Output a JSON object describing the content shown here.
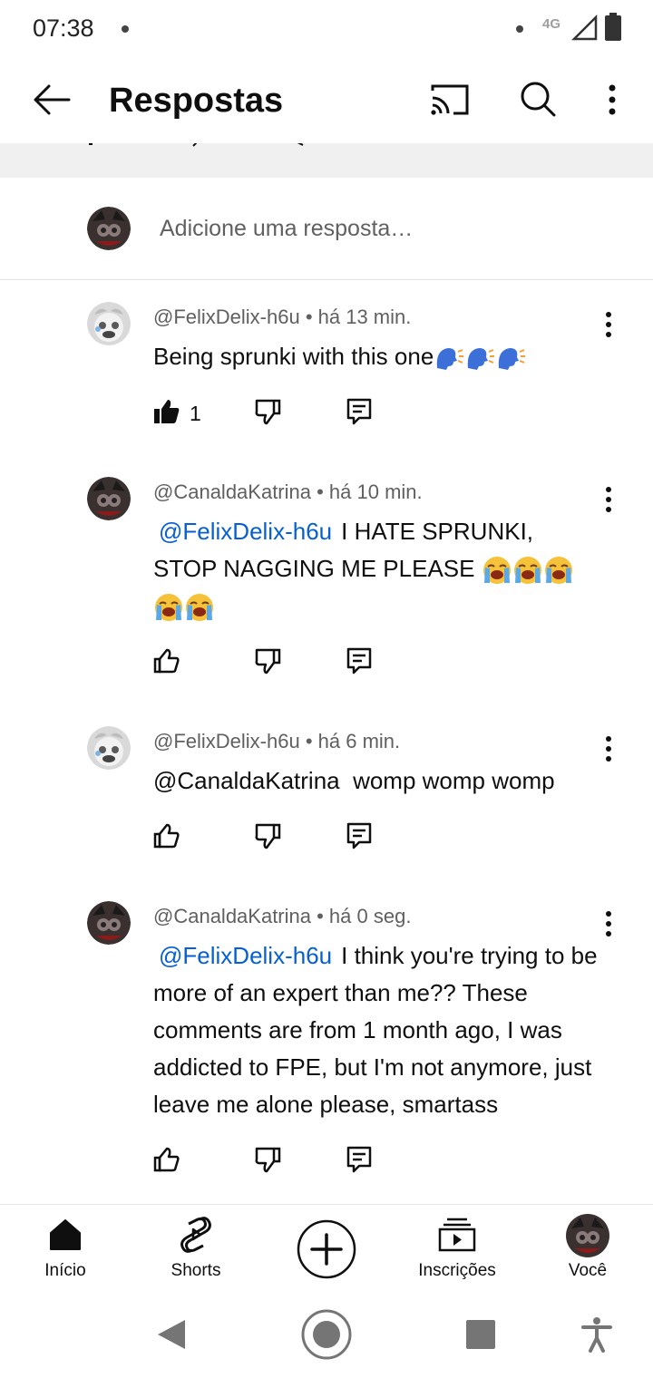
{
  "status": {
    "time": "07:38",
    "network": "4G"
  },
  "header": {
    "title": "Respostas"
  },
  "add_reply": {
    "placeholder": "Adicione uma resposta…"
  },
  "comments": [
    {
      "author": "@FelixDelix-h6u",
      "age": "há 13 min.",
      "meta": "@FelixDelix-h6u • há 13 min.",
      "text": "Being sprunki with this one",
      "emoji": [
        "speaking-head",
        "speaking-head",
        "speaking-head"
      ],
      "likes": "1",
      "liked": true
    },
    {
      "author": "@CanaldaKatrina",
      "age": "há 10 min.",
      "meta": "@CanaldaKatrina • há 10 min.",
      "mention": "@FelixDelix-h6u",
      "text_line1": "I HATE SPRUNKI,",
      "text_line2": "STOP NAGGING ME PLEASE",
      "emoji": [
        "loudly-crying-face",
        "loudly-crying-face",
        "loudly-crying-face",
        "loudly-crying-face",
        "loudly-crying-face"
      ],
      "likes": "",
      "liked": false
    },
    {
      "author": "@FelixDelix-h6u",
      "age": "há 6 min.",
      "meta": "@FelixDelix-h6u • há 6 min.",
      "text": "@CanaldaKatrina  womp womp womp",
      "likes": "",
      "liked": false
    },
    {
      "author": "@CanaldaKatrina",
      "age": "há 0 seg.",
      "meta": "@CanaldaKatrina • há 0 seg.",
      "mention": "@FelixDelix-h6u",
      "text_line1": "I think you're trying to",
      "text_rest": "be more of an expert than me?? These comments are from 1 month ago, I was addicted to FPE, but I'm not anymore, just leave me alone please, smartass",
      "likes": "",
      "liked": false
    }
  ],
  "bottom_nav": {
    "home": "Início",
    "shorts": "Shorts",
    "subscriptions": "Inscrições",
    "you": "Você"
  },
  "colors": {
    "mention": "#065fd4",
    "meta": "#606060",
    "text": "#0f0f0f",
    "strip": "#f0f0f0"
  }
}
